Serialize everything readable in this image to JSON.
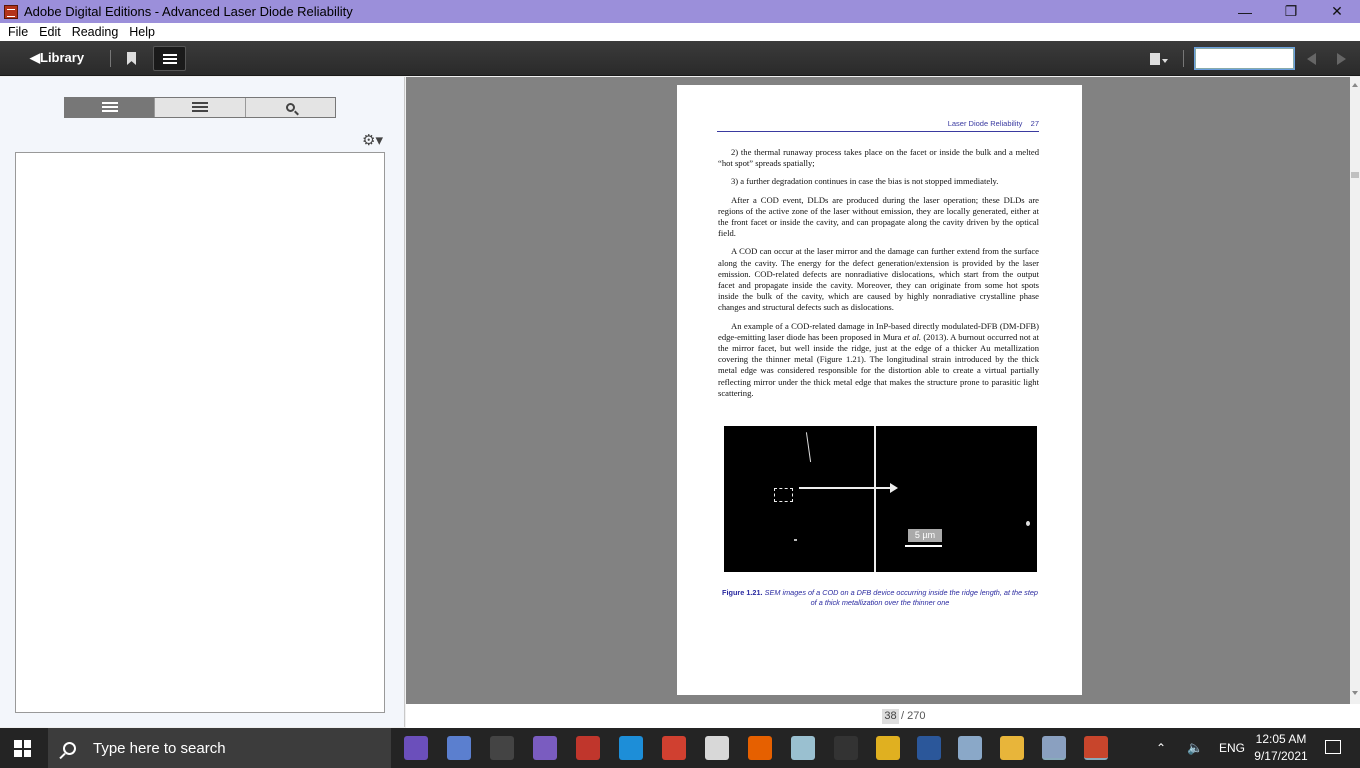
{
  "window": {
    "title": "Adobe Digital Editions - Advanced Laser Diode Reliability",
    "min": "—",
    "restore": "❐",
    "close": "✕"
  },
  "menu": [
    "File",
    "Edit",
    "Reading",
    "Help"
  ],
  "toolbar": {
    "library_label": "◀Library",
    "search_value": ""
  },
  "page": {
    "running_head": "Laser Diode Reliability    27",
    "paragraphs": [
      "2) the thermal runaway process takes place on the facet or inside the bulk and a melted “hot spot” spreads spatially;",
      "3) a further degradation continues in case the bias is not stopped immediately.",
      "After a COD event, DLDs are produced during the laser operation; these DLDs are regions of the active zone of the laser without emission, they are locally generated, either at the front facet or inside the cavity, and can propagate along the cavity driven by the optical field.",
      "A COD can occur at the laser mirror and the damage can further extend from the surface along the cavity. The energy for the defect generation/extension is provided by the laser emission. COD-related defects are nonradiative dislocations, which start from the output facet and propagate inside the cavity. Moreover, they can originate from some hot spots inside the bulk of the cavity, which are caused by highly nonradiative crystalline phase changes and structural defects such as dislocations."
    ],
    "p5_before": "An example of a COD-related damage in InP-based directly modulated-DFB (DM-DFB) edge-emitting laser diode has been proposed in Mura ",
    "p5_italic": "et al.",
    "p5_after": " (2013). A burnout occurred not at the mirror facet, but well inside the ridge, just at the edge of a thicker Au metallization covering the thinner metal (Figure 1.21). The longitudinal strain introduced by the thick metal edge was considered responsible for the distortion able to create a virtual partially reflecting mirror under the thick metal edge that makes the structure prone to parasitic light scattering.",
    "figure_scale": "5 µm",
    "caption_label": "Figure 1.21.",
    "caption_text": " SEM images of a COD on a DFB device occurring inside the ridge length, at the step of a thick metallization over the thinner one"
  },
  "pagination": {
    "current": "38",
    "total": "/ 270"
  },
  "taskbar": {
    "search_placeholder": "Type here to search",
    "lang": "ENG",
    "time": "12:05 AM",
    "date": "9/17/2021",
    "apps": [
      {
        "name": "visual-studio-icon",
        "color": "#6b4fbb"
      },
      {
        "name": "file-manager-icon",
        "color": "#5b7fcf"
      },
      {
        "name": "fontforge-icon",
        "color": "#444444"
      },
      {
        "name": "app-purple-icon",
        "color": "#7a5cc0"
      },
      {
        "name": "app-red-icon",
        "color": "#c0362c"
      },
      {
        "name": "app-blue-icon",
        "color": "#1d8ed8"
      },
      {
        "name": "app-tools-icon",
        "color": "#d04030"
      },
      {
        "name": "pdf-icon",
        "color": "#d8d8d8"
      },
      {
        "name": "firefox-icon",
        "color": "#e66000"
      },
      {
        "name": "app-glass-icon",
        "color": "#9ac0d0"
      },
      {
        "name": "app-figure-icon",
        "color": "#333333"
      },
      {
        "name": "app-headphones-icon",
        "color": "#e0b020"
      },
      {
        "name": "word-icon",
        "color": "#2b579a"
      },
      {
        "name": "network-icon",
        "color": "#8aa8c8"
      },
      {
        "name": "folder-icon",
        "color": "#e8b53a"
      },
      {
        "name": "file-explorer-icon",
        "color": "#8aa0c0"
      },
      {
        "name": "digital-editions-icon",
        "color": "#c8452c"
      }
    ]
  }
}
